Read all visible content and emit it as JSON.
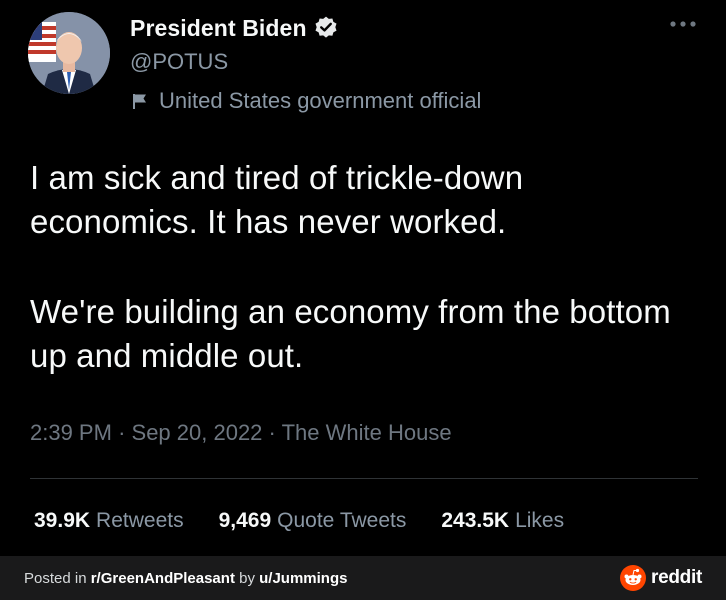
{
  "tweet": {
    "display_name": "President Biden",
    "handle": "@POTUS",
    "label": "United States government official",
    "text_paragraphs": [
      "I am sick and tired of trickle-down economics. It has never worked.",
      "We're building an economy from the bottom up and middle out."
    ],
    "time": "2:39 PM",
    "date": "Sep 20, 2022",
    "source": "The White House",
    "separator": "·",
    "stats": {
      "retweets_count": "39.9K",
      "retweets_label": "Retweets",
      "quote_count": "9,469",
      "quote_label": "Quote Tweets",
      "likes_count": "243.5K",
      "likes_label": "Likes"
    }
  },
  "footer": {
    "posted_in": "Posted in",
    "subreddit": "r/GreenAndPleasant",
    "by": "by",
    "user": "u/Jummings",
    "brand": "reddit"
  },
  "colors": {
    "background": "#000000",
    "primary_text": "#f7f9f9",
    "secondary_text": "#8b98a5",
    "footer_bg": "#1a1a1b",
    "reddit_orange": "#ff4500"
  },
  "icons": {
    "verified": "verified-badge-icon",
    "label": "flag-icon",
    "more": "more-horizontal-icon",
    "brand": "reddit-snoo-icon"
  }
}
